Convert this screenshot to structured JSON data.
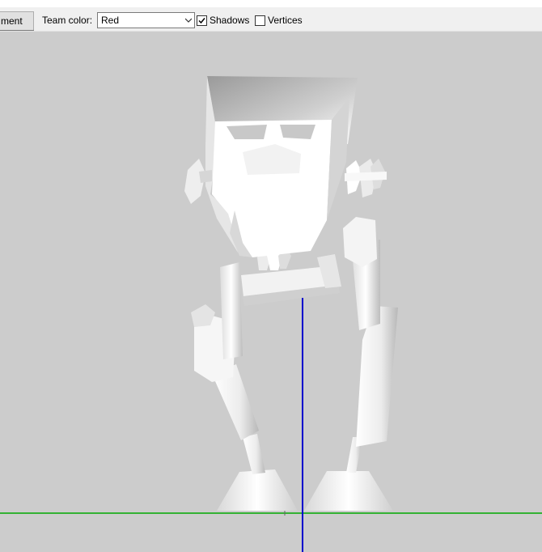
{
  "toolbar": {
    "tab_label": "ment",
    "team_color_label": "Team color:",
    "team_color_value": "Red",
    "shadows_label": "Shadows",
    "shadows_checked": true,
    "vertices_label": "Vertices",
    "vertices_checked": false
  },
  "viewport": {
    "model": "walker-robot",
    "background": "#cccccc",
    "ground_axis_color": "#00aa00",
    "vertical_axis_color": "#0000cc"
  }
}
